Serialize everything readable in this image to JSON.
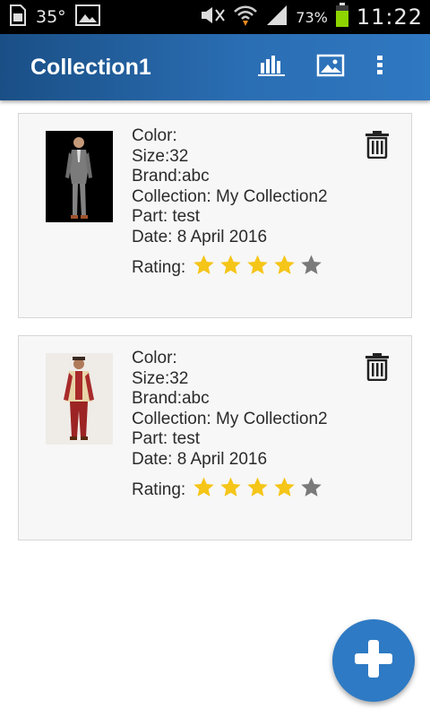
{
  "status_bar": {
    "temperature": "35°",
    "battery_percent": "73%",
    "time": "11:22"
  },
  "app_bar": {
    "title": "Collection1",
    "actions": [
      {
        "icon": "bar-chart-icon"
      },
      {
        "icon": "image-icon"
      },
      {
        "icon": "more-vert-icon"
      }
    ]
  },
  "items": [
    {
      "color_label": "Color:",
      "size_label": "Size:32",
      "brand_label": "Brand:abc",
      "collection_label": "Collection: My Collection2",
      "part_label": "Part: test",
      "date_label": "Date: 8 April 2016",
      "rating_label": "Rating:",
      "rating": 4,
      "rating_max": 5
    },
    {
      "color_label": "Color:",
      "size_label": "Size:32",
      "brand_label": "Brand:abc",
      "collection_label": "Collection: My Collection2",
      "part_label": "Part: test",
      "date_label": "Date: 8 April 2016",
      "rating_label": "Rating:",
      "rating": 4,
      "rating_max": 5
    }
  ],
  "colors": {
    "app_bar": "#2a6db2",
    "fab": "#2e7ac4",
    "star_filled": "#f5c518",
    "star_empty": "#7a7a7a"
  }
}
